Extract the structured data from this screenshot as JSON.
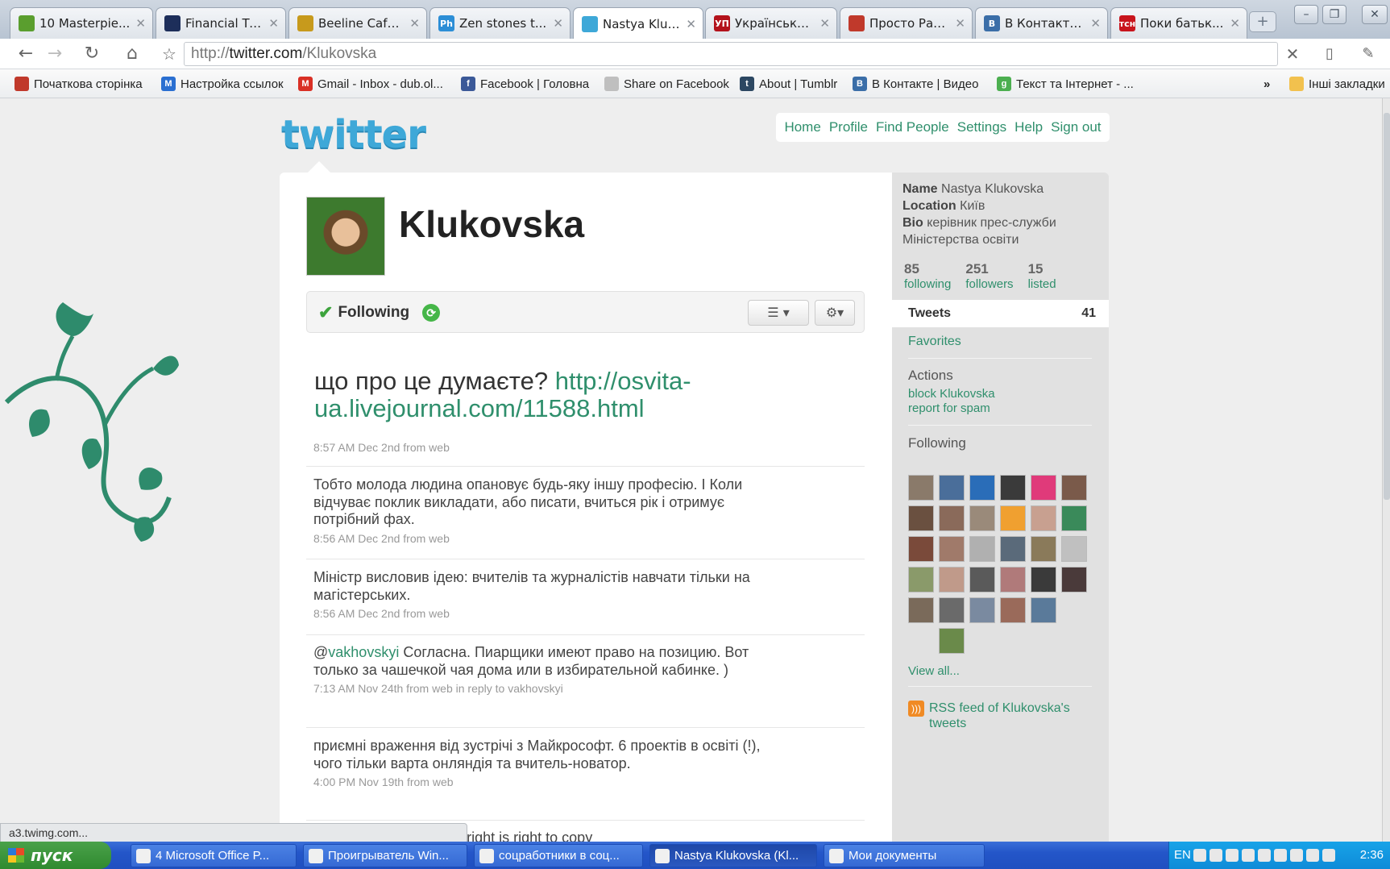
{
  "browser": {
    "tabs": [
      {
        "title": "10 Masterpie...",
        "icon_color": "#5a9e2e",
        "glyph": ""
      },
      {
        "title": "Financial Tim...",
        "icon_color": "#1d2e5a",
        "glyph": ""
      },
      {
        "title": "Beeline Café...",
        "icon_color": "#c79a1c",
        "glyph": ""
      },
      {
        "title": "Zen stones t...",
        "icon_color": "#2c8ed6",
        "glyph": "Ph"
      },
      {
        "title": "Nastya Kluko...",
        "icon_color": "#3ea8d8",
        "glyph": ""
      },
      {
        "title": "Українська ...",
        "icon_color": "#b3121b",
        "glyph": "УП"
      },
      {
        "title": "Просто Раді.О",
        "icon_color": "#c0392b",
        "glyph": ""
      },
      {
        "title": "В Контакте ...",
        "icon_color": "#3b6ea8",
        "glyph": "В"
      },
      {
        "title": "Поки батьк...",
        "icon_color": "#c8141c",
        "glyph": "тсн"
      }
    ],
    "url_prefix": "http://",
    "url_domain": "twitter.com",
    "url_path": "/Klukovska",
    "bookmarks": [
      {
        "label": "Початкова сторінка",
        "icon_color": "#c0392b",
        "glyph": ""
      },
      {
        "label": "Настройка ссылок",
        "icon_color": "#2a6fd1",
        "glyph": "M"
      },
      {
        "label": "Gmail - Inbox - dub.ol...",
        "icon_color": "#d93025",
        "glyph": "M"
      },
      {
        "label": "Facebook | Головна",
        "icon_color": "#3b5998",
        "glyph": "f"
      },
      {
        "label": "Share on Facebook",
        "icon_color": "#bfbfbf",
        "glyph": ""
      },
      {
        "label": "About | Tumblr",
        "icon_color": "#2c4762",
        "glyph": "t"
      },
      {
        "label": "В Контакте | Видео",
        "icon_color": "#3b6ea8",
        "glyph": "B"
      },
      {
        "label": "Текст та Інтернет - ...",
        "icon_color": "#4caf50",
        "glyph": "g"
      }
    ],
    "overflow_label": "»",
    "other_bookmarks": "Інші закладки"
  },
  "page": {
    "logo": "twitter",
    "nav": [
      "Home",
      "Profile",
      "Find People",
      "Settings",
      "Help",
      "Sign out"
    ],
    "screen_name": "Klukovska",
    "following_label": "Following",
    "tweets": [
      {
        "text": "що про це думаєте? ",
        "link": "http://osvita-ua.livejournal.com/11588.html",
        "meta": "8:57 AM Dec 2nd from web"
      },
      {
        "text": "Тобто молода людина опановує будь-яку іншу професію. І Коли відчуває поклик викладати, або писати, вчиться рік і отримує потрібний фах.",
        "meta": "8:56 AM Dec 2nd from web"
      },
      {
        "text": "Міністр висловив ідею: вчителів та журналістів навчати тільки на магістерських.",
        "meta": "8:56 AM Dec 2nd from web"
      },
      {
        "mention": "@",
        "mention_link": "vakhovskyi",
        "text": " Согласна. Пиарщики имеют право на позицию. Вот только за чашечкой чая дома или в избирательной кабинке. )",
        "meta": "7:13 AM Nov 24th from web in reply to vakhovskyi"
      },
      {
        "text": "приємні враження від зустрічі з Майкрософт. 6 проектів в освіті (!), чого тільки варта онляндія та вчитель-новатор.",
        "meta": "4:00 PM Nov 19th from web"
      },
      {
        "text": "...people think that copyright is right to copy"
      }
    ]
  },
  "sidebar": {
    "name_label": "Name",
    "name": "Nastya Klukovska",
    "location_label": "Location",
    "location": "Київ",
    "bio_label": "Bio",
    "bio": "керівник прес-служби Міністерства освіти",
    "stats": [
      {
        "value": "85",
        "label": "following"
      },
      {
        "value": "251",
        "label": "followers"
      },
      {
        "value": "15",
        "label": "listed"
      }
    ],
    "tweets_label": "Tweets",
    "tweets_count": "41",
    "favorites": "Favorites",
    "actions_heading": "Actions",
    "block": "block Klukovska",
    "report": "report for spam",
    "following_heading": "Following",
    "following_thumbs": [
      "#8a7a6a",
      "#4a6e9a",
      "#2a6db8",
      "#3a3a3a",
      "#e03a7a",
      "#7a5a4a",
      "#6a5040",
      "#8a6a5a",
      "#9a8a7a",
      "#f0a030",
      "#c8a090",
      "#3a8a5a",
      "#7a4a3a",
      "#a07a6a",
      "#b0b0b0",
      "#5a6a7a",
      "#8a7a5a",
      "#c0c0c0",
      "#8a9a6a",
      "#c09a8a",
      "#5a5a5a",
      "#b07a7a",
      "#3a3a3a",
      "#4a3a3a",
      "#7a6a5a",
      "#6a6a6a",
      "#7a8aa0",
      "#9a6a5a",
      "#5a7a9a",
      "#6a8a4a"
    ],
    "view_all": "View all...",
    "rss": "RSS feed of Klukovska's tweets"
  },
  "status_url": "a3.twimg.com...",
  "taskbar": {
    "start": "пуск",
    "tasks": [
      {
        "label": "4 Microsoft Office P...",
        "active": false
      },
      {
        "label": "Проигрыватель Win...",
        "active": false
      },
      {
        "label": "соцработники в соц...",
        "active": false
      },
      {
        "label": "Nastya Klukovska (Kl...",
        "active": true
      },
      {
        "label": "Мои документы",
        "active": false
      }
    ],
    "lang": "EN",
    "clock": "2:36"
  }
}
